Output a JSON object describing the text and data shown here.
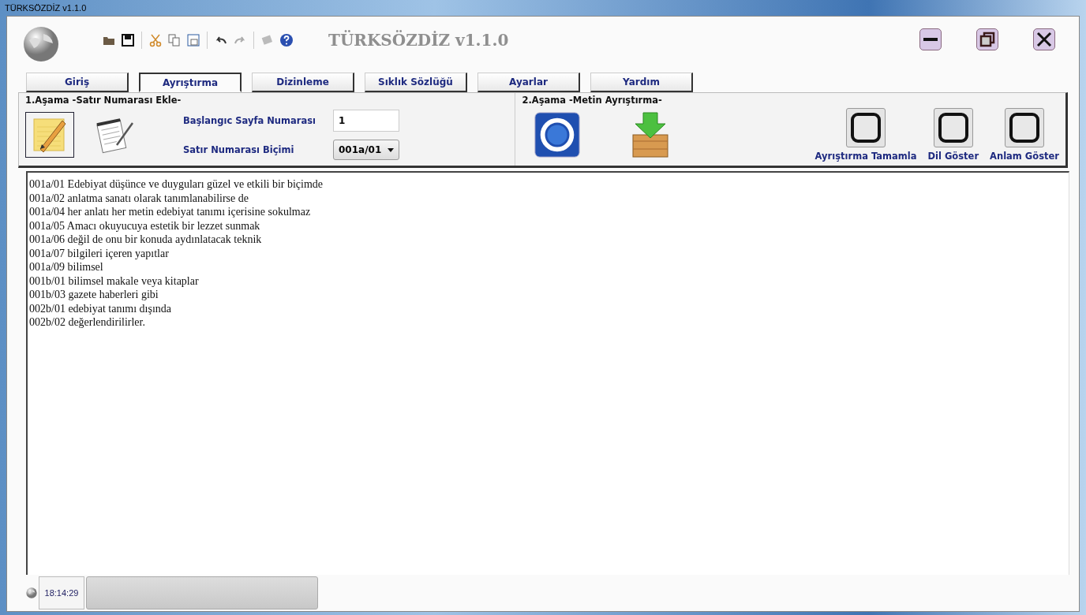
{
  "window": {
    "title": "TÜRKSÖZDİZ v1.1.0"
  },
  "header": {
    "app_title": "TÜRKSÖZDİZ v1.1.0"
  },
  "tabs": [
    {
      "label": "Giriş",
      "selected": false
    },
    {
      "label": "Ayrıştırma",
      "selected": true
    },
    {
      "label": "Dizinleme",
      "selected": false
    },
    {
      "label": "Sıklık Sözlüğü",
      "selected": false
    },
    {
      "label": "Ayarlar",
      "selected": false
    },
    {
      "label": "Yardım",
      "selected": false
    }
  ],
  "stage1": {
    "title": "1.Aşama -Satır Numarası Ekle-",
    "fields": [
      {
        "kind": "text",
        "label": "Başlangıc Sayfa Numarası",
        "value": "1"
      },
      {
        "kind": "select",
        "label": "Satır Numarası Biçimi",
        "value": "001a/01"
      }
    ]
  },
  "stage2": {
    "title": "2.Aşama -Metin Ayrıştırma-",
    "toggles": [
      {
        "label": "Ayrıştırma Tamamla",
        "checked": false
      },
      {
        "label": "Dil Göster",
        "checked": false
      },
      {
        "label": "Anlam Göster",
        "checked": false
      }
    ]
  },
  "lines": [
    "001a/01 Edebiyat düşünce ve duyguları güzel ve etkili bir biçimde",
    "001a/02 anlatma sanatı olarak tanımlanabilirse de",
    "001a/04 her anlatı her metin edebiyat tanımı içerisine sokulmaz",
    "001a/05 Amacı okuyucuya estetik bir lezzet sunmak",
    "001a/06 değil de onu bir konuda aydınlatacak teknik",
    "001a/07 bilgileri içeren yapıtlar",
    "001a/09 bilimsel",
    "001b/01 bilimsel makale veya kitaplar",
    "001b/03 gazete haberleri gibi",
    "002b/01 edebiyat tanımı dışında",
    "002b/02 değerlendirilirler."
  ],
  "status_bar": {
    "time": "18:14:29",
    "progress": {
      "level": 0
    }
  }
}
